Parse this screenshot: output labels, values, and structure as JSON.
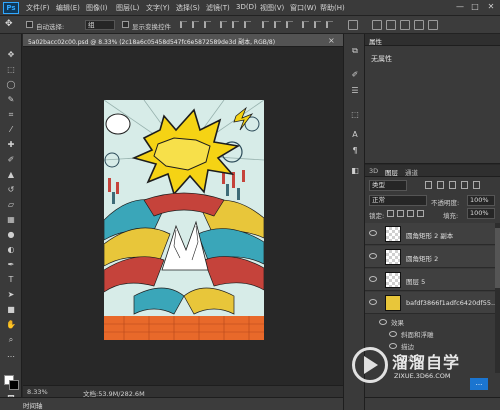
{
  "app": {
    "logo": "Ps"
  },
  "menu": [
    "文件(F)",
    "编辑(E)",
    "图像(I)",
    "图层(L)",
    "文字(Y)",
    "选择(S)",
    "滤镜(T)",
    "3D(D)",
    "视图(V)",
    "窗口(W)",
    "帮助(H)"
  ],
  "window_controls": {
    "minimize": "—",
    "restore": "□",
    "close": "✕"
  },
  "options": {
    "auto_select_label": "自动选择:",
    "auto_select_value": "组",
    "show_transform_label": "显示变换控件"
  },
  "document": {
    "tab_title": "5a02bacc02c00.psd @ 8.33% (2c18a6c05458d547fc6e5872589de3d 副本, RGB/8)",
    "tab_close": "×",
    "zoom": "8.33%",
    "doc_size": "文档:53.9M/282.6M"
  },
  "timeline_tab": "时间轴",
  "properties": {
    "tab": "属性",
    "message": "无属性"
  },
  "layers": {
    "tabs": [
      "3D",
      "图层",
      "通道"
    ],
    "filter_kind": "类型",
    "blend_mode": "正常",
    "opacity_label": "不透明度:",
    "opacity_value": "100%",
    "lock_label": "锁定:",
    "fill_label": "填充:",
    "fill_value": "100%",
    "rows": [
      {
        "name": "圆角矩形 2 副本"
      },
      {
        "name": "圆角矩形 2"
      },
      {
        "name": "图层 5"
      },
      {
        "name": "bafdf3866f1adfc6420df55..."
      }
    ],
    "effects_header": "效果",
    "effects": [
      "斜面和浮雕",
      "描边",
      "内发光"
    ]
  },
  "watermark": {
    "title": "溜溜自学",
    "url": "ZIXUE.3D66.COM"
  },
  "more_button": "..."
}
